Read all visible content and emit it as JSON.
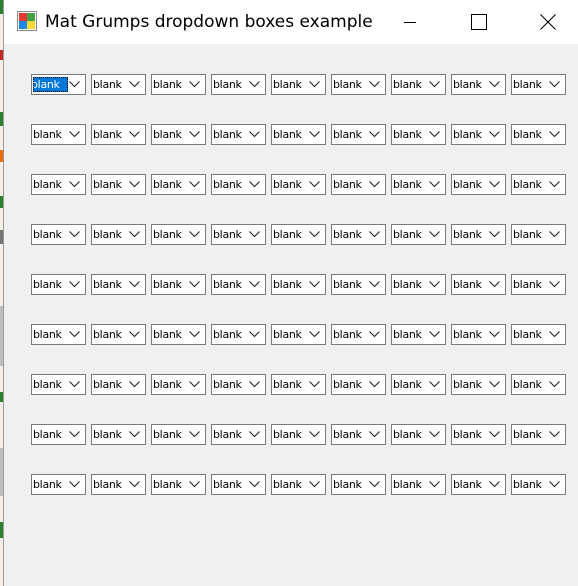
{
  "window": {
    "title": "Mat Grumps dropdown boxes example",
    "icon": "app-window-icon",
    "controls": [
      "minimize-icon",
      "maximize-icon",
      "close-icon"
    ]
  },
  "dropdowns": {
    "rows": 9,
    "columns": 9,
    "selected_value": "blank",
    "focused_row": 0,
    "focused_column": 0,
    "accent_color": "#0078d7",
    "border_color": "#7a7a7a"
  }
}
